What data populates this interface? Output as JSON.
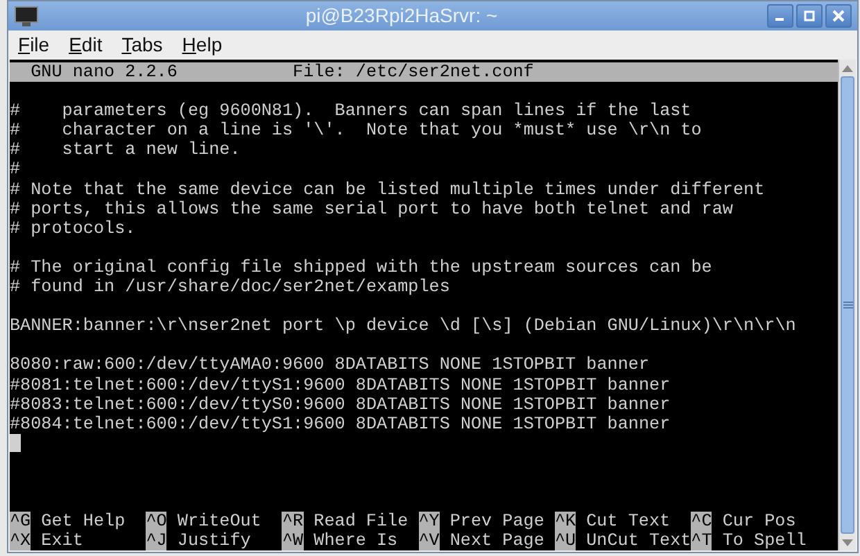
{
  "window": {
    "title": "pi@B23Rpi2HaSrvr: ~"
  },
  "menu": [
    {
      "label": "File",
      "underlined": true
    },
    {
      "label": "Edit",
      "underlined": true
    },
    {
      "label": "Tabs",
      "underlined": true
    },
    {
      "label": "Help",
      "underlined": true
    }
  ],
  "nano_header": {
    "version": "GNU nano 2.2.6",
    "file": "File: /etc/ser2net.conf"
  },
  "lines": [
    {
      "kind": "blank"
    },
    {
      "kind": "text",
      "text": "#    parameters (eg 9600N81).  Banners can span lines if the last"
    },
    {
      "kind": "text",
      "text": "#    character on a line is '\\'.  Note that you *must* use \\r\\n to"
    },
    {
      "kind": "text",
      "text": "#    start a new line."
    },
    {
      "kind": "text",
      "text": "#"
    },
    {
      "kind": "text",
      "text": "# Note that the same device can be listed multiple times under different"
    },
    {
      "kind": "text",
      "text": "# ports, this allows the same serial port to have both telnet and raw"
    },
    {
      "kind": "text",
      "text": "# protocols."
    },
    {
      "kind": "blank"
    },
    {
      "kind": "text",
      "text": "# The original config file shipped with the upstream sources can be"
    },
    {
      "kind": "text",
      "text": "# found in /usr/share/doc/ser2net/examples"
    },
    {
      "kind": "blank"
    },
    {
      "kind": "text",
      "text": "BANNER:banner:\\r\\nser2net port \\p device \\d [\\s] (Debian GNU/Linux)\\r\\n\\r\\n"
    },
    {
      "kind": "blank"
    },
    {
      "kind": "text",
      "text": "8080:raw:600:/dev/ttyAMA0:9600 8DATABITS NONE 1STOPBIT banner"
    },
    {
      "kind": "text",
      "text": "#8081:telnet:600:/dev/ttyS1:9600 8DATABITS NONE 1STOPBIT banner"
    },
    {
      "kind": "text",
      "text": "#8083:telnet:600:/dev/ttyS0:9600 8DATABITS NONE 1STOPBIT banner"
    },
    {
      "kind": "text",
      "text": "#8084:telnet:600:/dev/ttyS1:9600 8DATABITS NONE 1STOPBIT banner"
    },
    {
      "kind": "cursor"
    },
    {
      "kind": "blank"
    },
    {
      "kind": "blank"
    },
    {
      "kind": "blank"
    }
  ],
  "shortcuts": [
    [
      {
        "key": "^G",
        "label": "Get Help"
      },
      {
        "key": "^O",
        "label": "WriteOut"
      },
      {
        "key": "^R",
        "label": "Read File"
      },
      {
        "key": "^Y",
        "label": "Prev Page"
      },
      {
        "key": "^K",
        "label": "Cut Text"
      },
      {
        "key": "^C",
        "label": "Cur Pos"
      }
    ],
    [
      {
        "key": "^X",
        "label": "Exit"
      },
      {
        "key": "^J",
        "label": "Justify"
      },
      {
        "key": "^W",
        "label": "Where Is"
      },
      {
        "key": "^V",
        "label": "Next Page"
      },
      {
        "key": "^U",
        "label": "UnCut Text"
      },
      {
        "key": "^T",
        "label": "To Spell"
      }
    ]
  ]
}
